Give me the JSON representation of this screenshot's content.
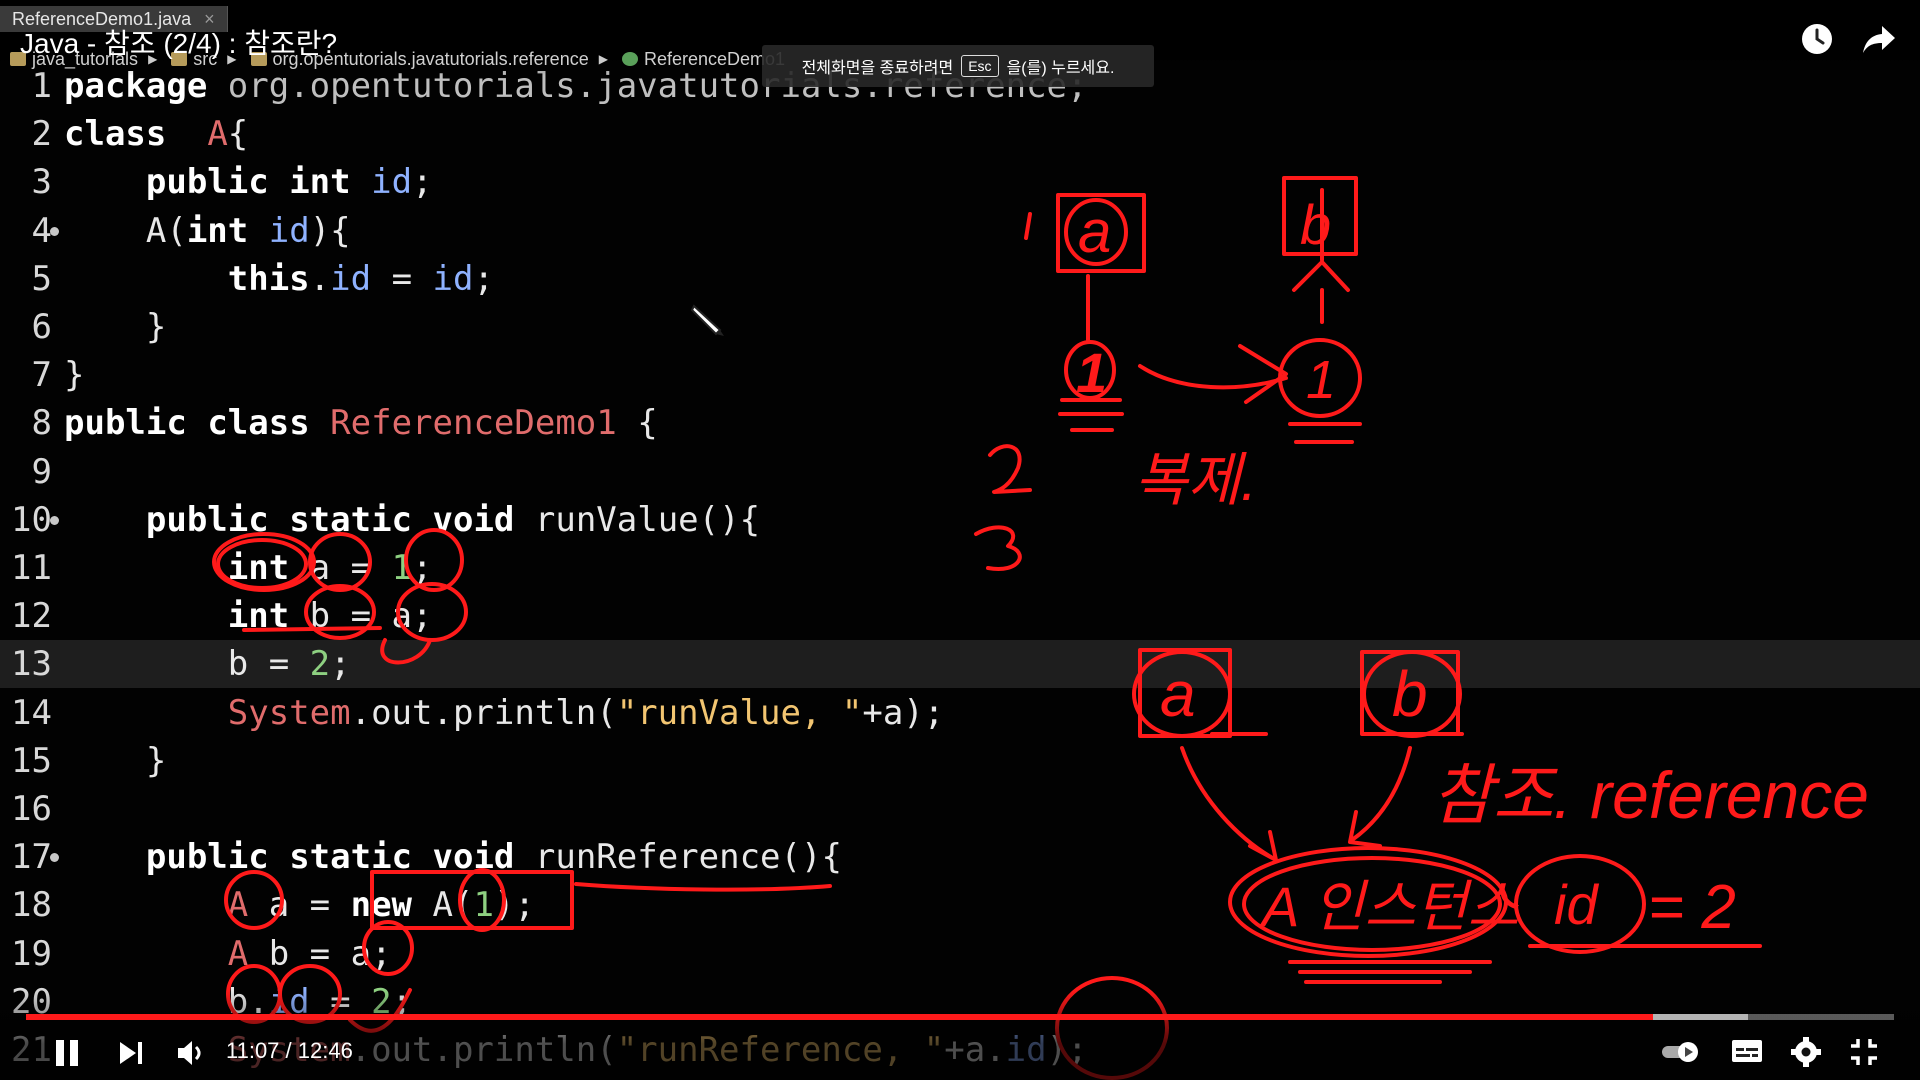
{
  "file_tab": "ReferenceDemo1.java",
  "video": {
    "title": "Java - 참조 (2/4) : 참조란?",
    "current_time": "11:07",
    "separator": " / ",
    "duration": "12:46",
    "progress": 0.871,
    "buffered": 0.922
  },
  "breadcrumb": [
    "java_tutorials",
    "src",
    "org.opentutorials.javatutorials.reference",
    "ReferenceDemo1"
  ],
  "fullscreen_hint": {
    "before": "전체화면을 종료하려면",
    "key": "Esc",
    "after": "을(를) 누르세요."
  },
  "lines": [
    {
      "n": "1",
      "t": [
        [
          "k",
          "package"
        ],
        [
          "p",
          " org.opentutorials.javatutorials.reference;"
        ]
      ]
    },
    {
      "n": "2",
      "t": [
        [
          "k",
          "class"
        ],
        [
          "",
          "  "
        ],
        [
          "c",
          "A"
        ],
        [
          "",
          "{"
        ]
      ]
    },
    {
      "n": "3",
      "t": [
        [
          "",
          "    "
        ],
        [
          "k",
          "public"
        ],
        [
          "",
          " "
        ],
        [
          "k",
          "int"
        ],
        [
          "",
          " "
        ],
        [
          "f",
          "id"
        ],
        [
          "",
          ";"
        ]
      ]
    },
    {
      "n": "4",
      "fold": true,
      "t": [
        [
          "",
          "    A("
        ],
        [
          "k",
          "int"
        ],
        [
          "",
          " "
        ],
        [
          "f",
          "id"
        ],
        [
          "",
          "){"
        ]
      ]
    },
    {
      "n": "5",
      "t": [
        [
          "",
          "        "
        ],
        [
          "k",
          "this"
        ],
        [
          "",
          "."
        ],
        [
          "f",
          "id"
        ],
        [
          "",
          " = "
        ],
        [
          "f",
          "id"
        ],
        [
          "",
          ";"
        ]
      ]
    },
    {
      "n": "6",
      "t": [
        [
          "",
          "    }"
        ]
      ]
    },
    {
      "n": "7",
      "t": [
        [
          "",
          "}"
        ]
      ]
    },
    {
      "n": "8",
      "t": [
        [
          "k",
          "public"
        ],
        [
          "",
          " "
        ],
        [
          "k",
          "class"
        ],
        [
          "",
          " "
        ],
        [
          "c",
          "ReferenceDemo1"
        ],
        [
          "",
          " {"
        ]
      ]
    },
    {
      "n": "9",
      "t": []
    },
    {
      "n": "10",
      "fold": true,
      "t": [
        [
          "",
          "    "
        ],
        [
          "k",
          "public"
        ],
        [
          "",
          " "
        ],
        [
          "k",
          "static"
        ],
        [
          "",
          " "
        ],
        [
          "k",
          "void"
        ],
        [
          "",
          " runValue(){"
        ]
      ]
    },
    {
      "n": "11",
      "t": [
        [
          "",
          "        "
        ],
        [
          "k",
          "int"
        ],
        [
          "",
          " a = "
        ],
        [
          "n",
          "1"
        ],
        [
          "",
          ";"
        ]
      ]
    },
    {
      "n": "12",
      "t": [
        [
          "",
          "        "
        ],
        [
          "k",
          "int"
        ],
        [
          "",
          " b = a;"
        ]
      ]
    },
    {
      "n": "13",
      "current": true,
      "t": [
        [
          "",
          "        b = "
        ],
        [
          "n",
          "2"
        ],
        [
          "",
          ";"
        ]
      ]
    },
    {
      "n": "14",
      "t": [
        [
          "",
          "        "
        ],
        [
          "s",
          "System"
        ],
        [
          "",
          ".out.println("
        ],
        [
          "q",
          "\"runValue, \""
        ],
        [
          "",
          "+a);"
        ]
      ]
    },
    {
      "n": "15",
      "t": [
        [
          "",
          "    }"
        ]
      ]
    },
    {
      "n": "16",
      "t": []
    },
    {
      "n": "17",
      "fold": true,
      "t": [
        [
          "",
          "    "
        ],
        [
          "k",
          "public"
        ],
        [
          "",
          " "
        ],
        [
          "k",
          "static"
        ],
        [
          "",
          " "
        ],
        [
          "k",
          "void"
        ],
        [
          "",
          " runReference(){"
        ]
      ]
    },
    {
      "n": "18",
      "t": [
        [
          "",
          "        "
        ],
        [
          "c",
          "A"
        ],
        [
          "",
          " a = "
        ],
        [
          "k",
          "new"
        ],
        [
          "",
          " A("
        ],
        [
          "n",
          "1"
        ],
        [
          "",
          ");"
        ]
      ]
    },
    {
      "n": "19",
      "t": [
        [
          "",
          "        "
        ],
        [
          "c",
          "A"
        ],
        [
          "",
          " b = a;"
        ]
      ]
    },
    {
      "n": "20",
      "t": [
        [
          "",
          "        b."
        ],
        [
          "f",
          "id"
        ],
        [
          "",
          " = "
        ],
        [
          "n",
          "2"
        ],
        [
          "",
          ";"
        ]
      ]
    },
    {
      "n": "21",
      "t": [
        [
          "",
          "        "
        ],
        [
          "s",
          "System"
        ],
        [
          "",
          ".out.println("
        ],
        [
          "q",
          "\"runReference, \""
        ],
        [
          "",
          "+a."
        ],
        [
          "f",
          "id"
        ],
        [
          "",
          ");"
        ]
      ]
    }
  ],
  "annotations": {
    "copy_label": "복제.",
    "reference_label": "참조. reference",
    "instance_label": "A 인스턴스",
    "id_label": "id",
    "eq_value": "= 2",
    "var_a": "a",
    "var_b": "b",
    "val_one": "1",
    "num_two": "2",
    "num_three": "3"
  },
  "colors": {
    "ink": "#ff1a1a",
    "progress": "#ff1a1a"
  },
  "icons": [
    "watch-later-icon",
    "share-icon",
    "pause-icon",
    "next-icon",
    "volume-icon",
    "autoplay-toggle-icon",
    "subtitles-icon",
    "settings-icon",
    "exit-fullscreen-icon",
    "pen-cursor-icon"
  ]
}
